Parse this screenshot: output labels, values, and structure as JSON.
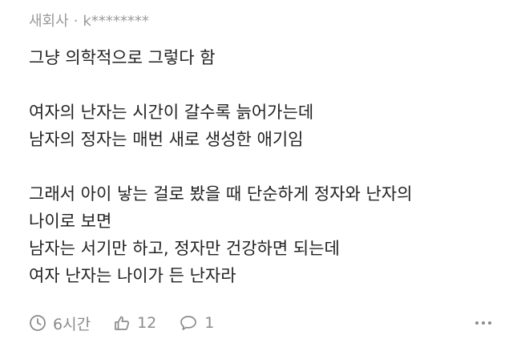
{
  "comment": {
    "author": "새회사",
    "separator": "·",
    "user_id": "k********",
    "lines": [
      "그냥 의학적으로 그렇다 함",
      "",
      "여자의 난자는 시간이 갈수록 늙어가는데",
      "남자의 정자는 매번 새로 생성한 애기임",
      "",
      "그래서 아이 낳는 걸로 봤을 때 단순하게 정자와 난자의",
      "나이로 보면",
      "남자는 서기만 하고, 정자만 건강하면 되는데",
      "여자 난자는 나이가 든 난자라"
    ],
    "time_label": "6시간",
    "like_count": "12",
    "reply_count": "1"
  },
  "icons": {
    "time": "clock-icon",
    "like": "thumbs-up-icon",
    "reply": "speech-bubble-icon",
    "more": "more-dots-icon"
  },
  "colors": {
    "text": "#222222",
    "meta": "#9a9a9a",
    "footer": "#8a8a8a"
  }
}
